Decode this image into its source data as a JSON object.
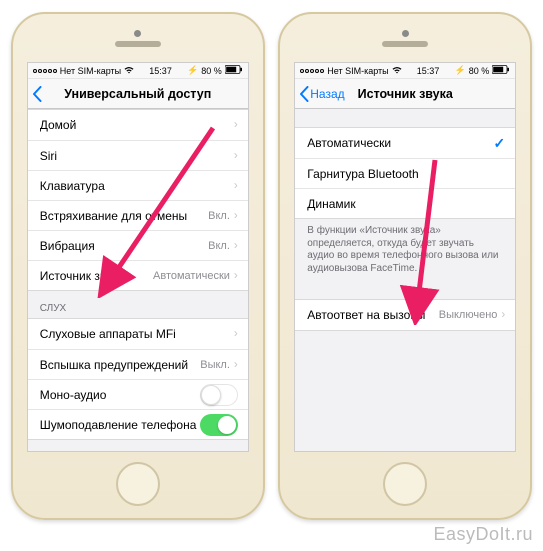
{
  "status": {
    "carrier": "Нет SIM-карты",
    "time": "15:37",
    "battery": "80 %"
  },
  "watermark": "EasyDoIt.ru",
  "left": {
    "nav": {
      "back": "",
      "title": "Универсальный доступ"
    },
    "rows": [
      {
        "label": "Домой",
        "value": "",
        "chevron": true
      },
      {
        "label": "Siri",
        "value": "",
        "chevron": true
      },
      {
        "label": "Клавиатура",
        "value": "",
        "chevron": true
      },
      {
        "label": "Встряхивание для отмены",
        "value": "Вкл.",
        "chevron": true
      },
      {
        "label": "Вибрация",
        "value": "Вкл.",
        "chevron": true
      },
      {
        "label": "Источник звука",
        "value": "Автоматически",
        "chevron": true
      }
    ],
    "section2_header": "СЛУХ",
    "rows2": [
      {
        "label": "Слуховые аппараты MFi",
        "value": "",
        "chevron": true
      },
      {
        "label": "Вспышка предупреждений",
        "value": "Выкл.",
        "chevron": true
      },
      {
        "label": "Моно-аудио",
        "toggle": "off"
      },
      {
        "label": "Шумоподавление телефона",
        "toggle": "on"
      }
    ]
  },
  "right": {
    "nav": {
      "back": "Назад",
      "title": "Источник звука"
    },
    "rows": [
      {
        "label": "Автоматически",
        "check": true
      },
      {
        "label": "Гарнитура Bluetooth"
      },
      {
        "label": "Динамик"
      }
    ],
    "footer": "В функции «Источник звука» определяется, откуда будет звучать аудио во время телефонного вызова или аудиовызова FaceTime.",
    "rows2": [
      {
        "label": "Автоответ на вызовы",
        "value": "Выключено",
        "chevron": true
      }
    ]
  }
}
